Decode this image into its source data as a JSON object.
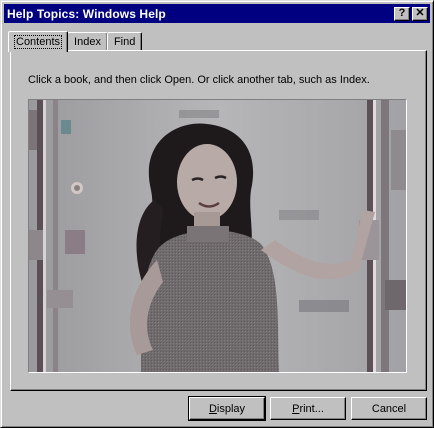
{
  "window": {
    "title": "Help Topics: Windows Help",
    "help_button": "?",
    "close_button": "✕"
  },
  "tabs": [
    {
      "label": "Contents",
      "active": true
    },
    {
      "label": "Index",
      "active": false
    },
    {
      "label": "Find",
      "active": false
    }
  ],
  "instructions": "Click a book, and then click Open. Or click another tab, such as Index.",
  "buttons": {
    "display": {
      "label": "Display",
      "mnemonic": "D",
      "rest": "isplay"
    },
    "print": {
      "label": "Print...",
      "mnemonic": "P",
      "rest": "rint..."
    },
    "cancel": {
      "label": "Cancel"
    }
  }
}
